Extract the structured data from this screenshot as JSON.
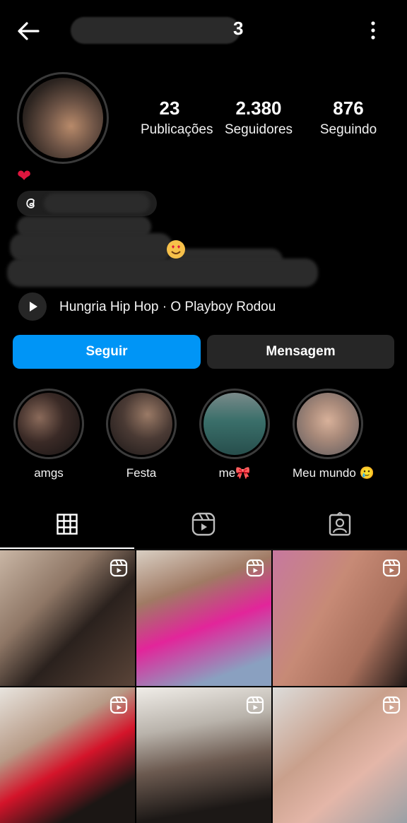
{
  "header": {
    "username_visible_fragment": "3"
  },
  "profile": {
    "stats": [
      {
        "value": "23",
        "label": "Publicações"
      },
      {
        "value": "2.380",
        "label": "Seguidores"
      },
      {
        "value": "876",
        "label": "Seguindo"
      }
    ],
    "bio_heart": "❤"
  },
  "music": {
    "track": "Hungria Hip Hop · O Playboy Rodou"
  },
  "actions": {
    "follow_label": "Seguir",
    "message_label": "Mensagem"
  },
  "highlights": [
    {
      "label": "amgs"
    },
    {
      "label": "Festa"
    },
    {
      "label": "me🎀"
    },
    {
      "label": "Meu mundo 🥲"
    }
  ],
  "tabs": [
    {
      "icon": "grid-icon"
    },
    {
      "icon": "reels-icon"
    },
    {
      "icon": "tagged-icon"
    }
  ],
  "colors": {
    "accent": "#0095f6",
    "background": "#000000",
    "button_secondary": "#262626"
  }
}
